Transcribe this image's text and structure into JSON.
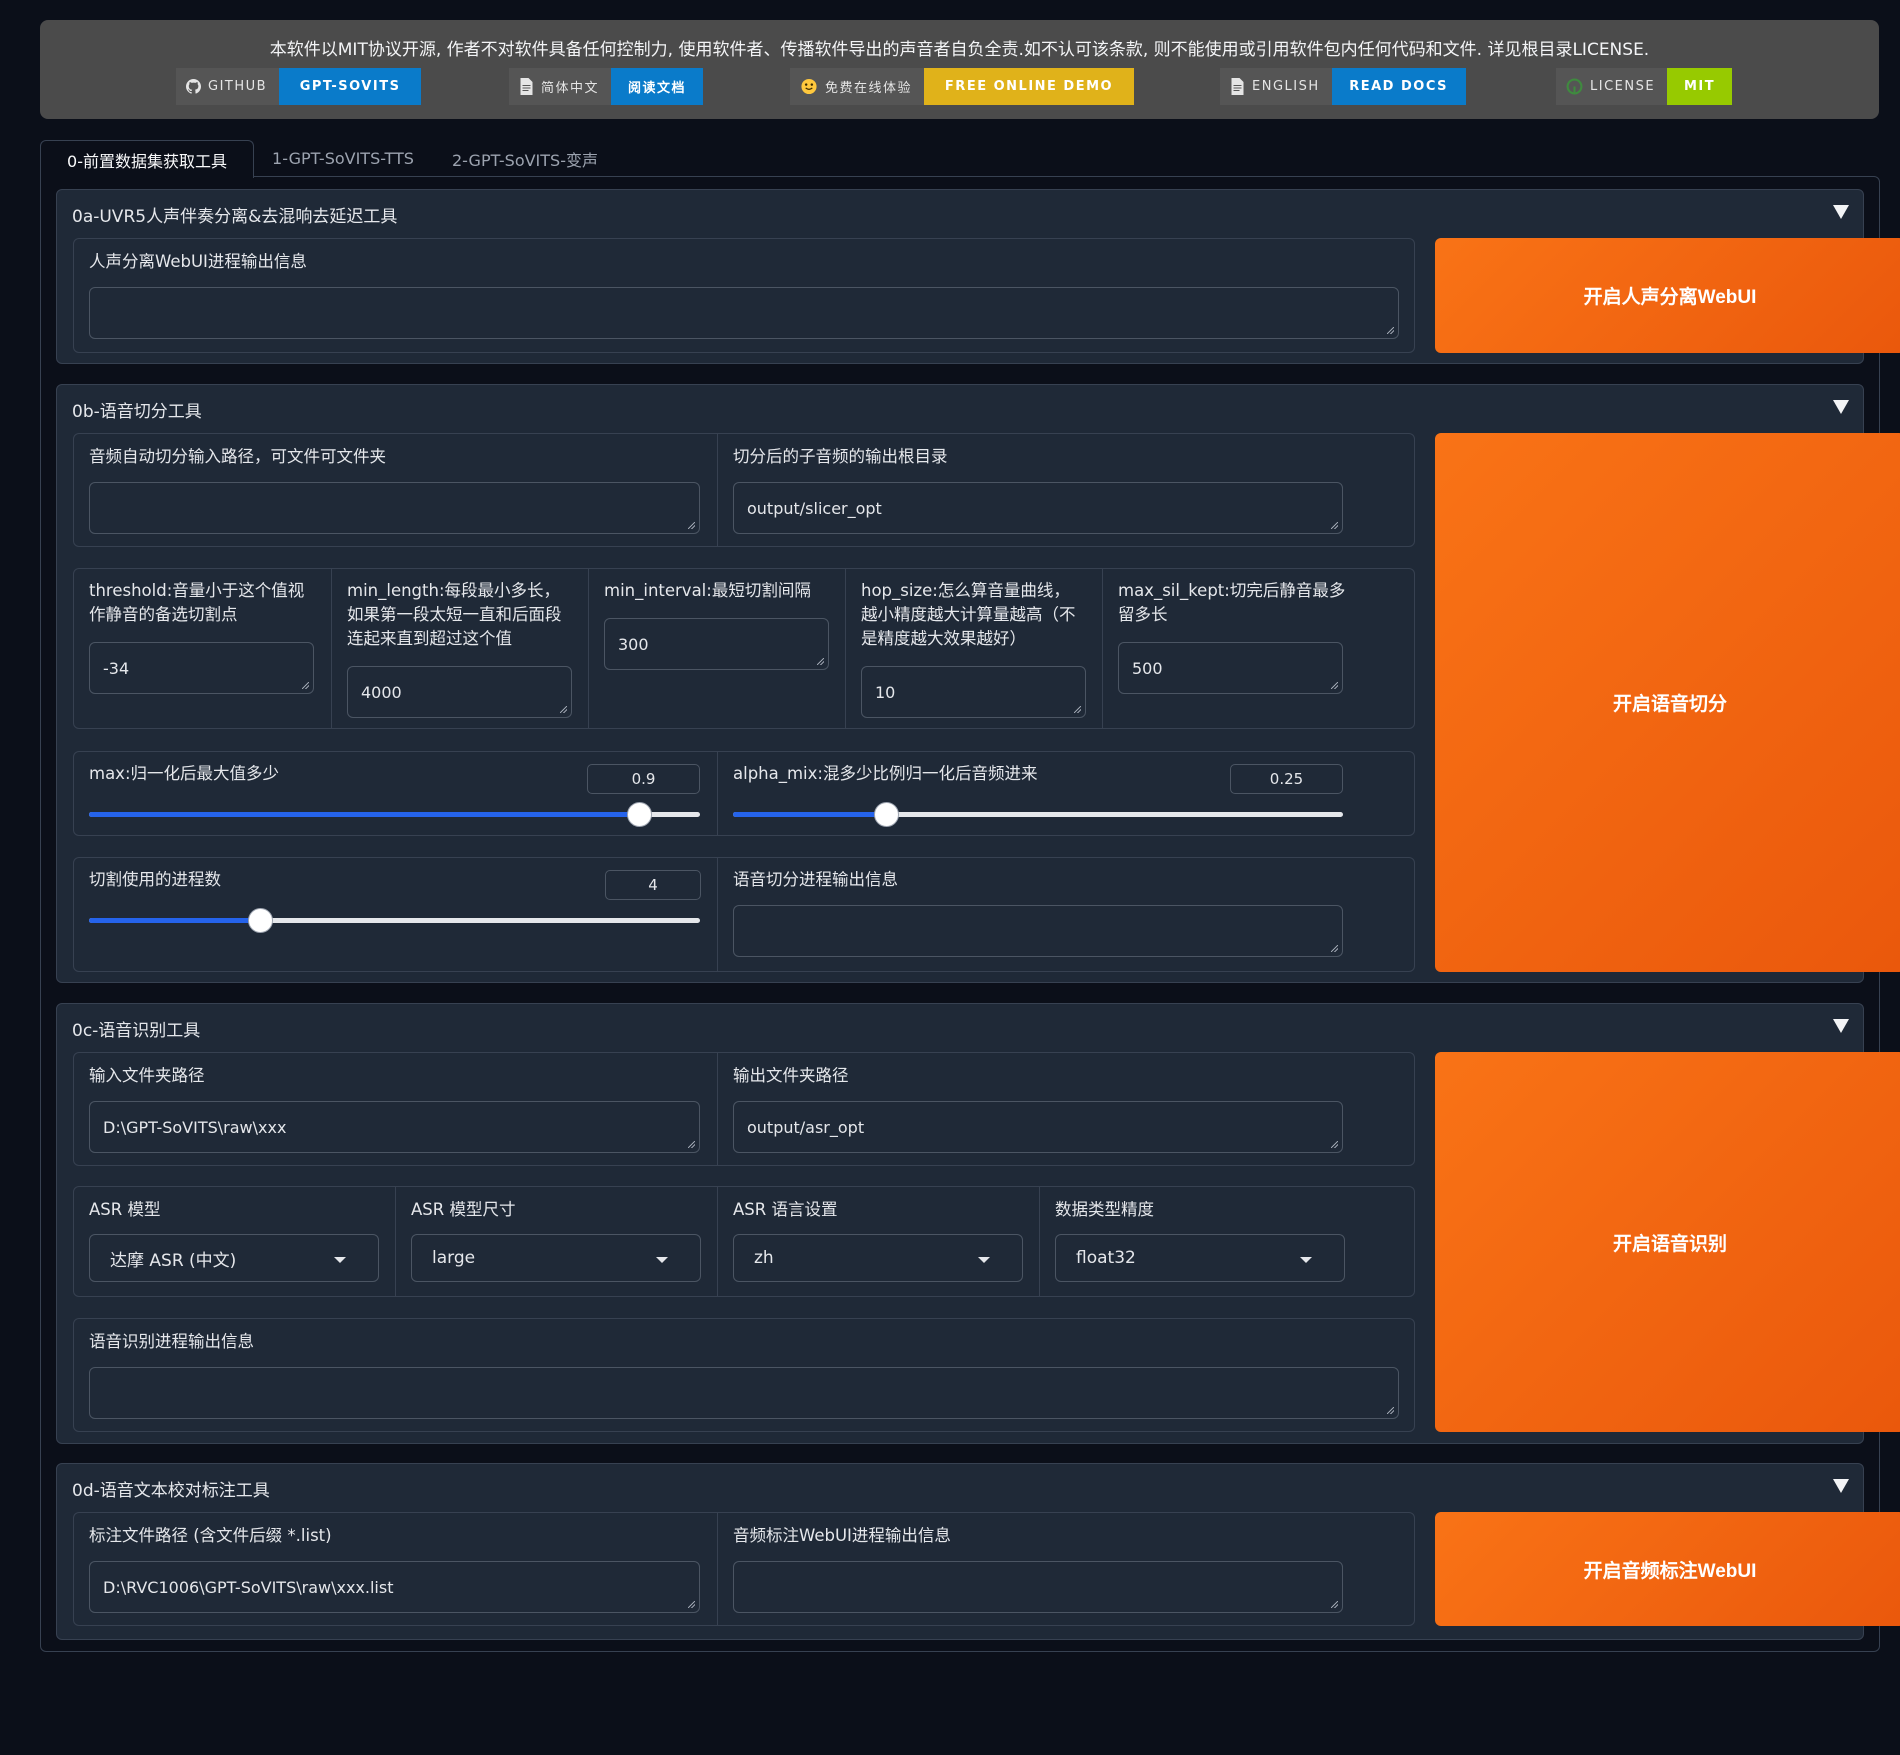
{
  "banner": {
    "notice": "本软件以MIT协议开源, 作者不对软件具备任何控制力, 使用软件者、传播软件导出的声音者自负全责.如不认可该条款, 则不能使用或引用软件包内任何代码和文件. 详见根目录LICENSE.",
    "badges": [
      {
        "label": "GITHUB",
        "value": "GPT-SOVITS",
        "icon": "github-icon",
        "color": "#0a7bca"
      },
      {
        "label": "简体中文",
        "value": "阅读文档",
        "icon": "document-icon",
        "color": "#0a7bca"
      },
      {
        "label": "免费在线体验",
        "value": "FREE ONLINE DEMO",
        "icon": "huggingface-icon",
        "color": "#e0b21a"
      },
      {
        "label": "ENGLISH",
        "value": "READ DOCS",
        "icon": "document-icon",
        "color": "#0a7bca"
      },
      {
        "label": "LICENSE",
        "value": "MIT",
        "icon": "license-icon",
        "color": "#97ca00"
      }
    ]
  },
  "tabs": [
    {
      "label": "0-前置数据集获取工具",
      "active": true
    },
    {
      "label": "1-GPT-SoVITS-TTS",
      "active": false
    },
    {
      "label": "2-GPT-SoVITS-变声",
      "active": false
    }
  ],
  "uvr5": {
    "title": "0a-UVR5人声伴奏分离&去混响去延迟工具",
    "output_label": "人声分离WebUI进程输出信息",
    "output_value": "",
    "button": "开启人声分离WebUI"
  },
  "slicer": {
    "title": "0b-语音切分工具",
    "input_path_label": "音频自动切分输入路径，可文件可文件夹",
    "input_path_value": "",
    "output_root_label": "切分后的子音频的输出根目录",
    "output_root_value": "output/slicer_opt",
    "threshold_label": "threshold:音量小于这个值视作静音的备选切割点",
    "threshold_value": "-34",
    "min_length_label": "min_length:每段最小多长，如果第一段太短一直和后面段连起来直到超过这个值",
    "min_length_value": "4000",
    "min_interval_label": "min_interval:最短切割间隔",
    "min_interval_value": "300",
    "hop_size_label": "hop_size:怎么算音量曲线，越小精度越大计算量越高（不是精度越大效果越好）",
    "hop_size_value": "10",
    "max_sil_kept_label": "max_sil_kept:切完后静音最多留多长",
    "max_sil_kept_value": "500",
    "max_label": "max:归一化后最大值多少",
    "max_value": "0.9",
    "max_fraction": 0.9,
    "alpha_label": "alpha_mix:混多少比例归一化后音频进来",
    "alpha_value": "0.25",
    "alpha_fraction": 0.25,
    "procs_label": "切割使用的进程数",
    "procs_value": "4",
    "procs_fraction": 0.28,
    "output_label": "语音切分进程输出信息",
    "output_value": "",
    "button": "开启语音切分"
  },
  "asr": {
    "title": "0c-语音识别工具",
    "input_label": "输入文件夹路径",
    "input_value": "D:\\GPT-SoVITS\\raw\\xxx",
    "output_label": "输出文件夹路径",
    "output_value": "output/asr_opt",
    "model_label": "ASR 模型",
    "model_value": "达摩 ASR (中文)",
    "size_label": "ASR 模型尺寸",
    "size_value": "large",
    "lang_label": "ASR 语言设置",
    "lang_value": "zh",
    "precision_label": "数据类型精度",
    "precision_value": "float32",
    "log_label": "语音识别进程输出信息",
    "log_value": "",
    "button": "开启语音识别"
  },
  "labeler": {
    "title": "0d-语音文本校对标注工具",
    "path_label": "标注文件路径 (含文件后缀 *.list)",
    "path_value": "D:\\RVC1006\\GPT-SoVITS\\raw\\xxx.list",
    "log_label": "音频标注WebUI进程输出信息",
    "log_value": "",
    "button": "开启音频标注WebUI"
  }
}
